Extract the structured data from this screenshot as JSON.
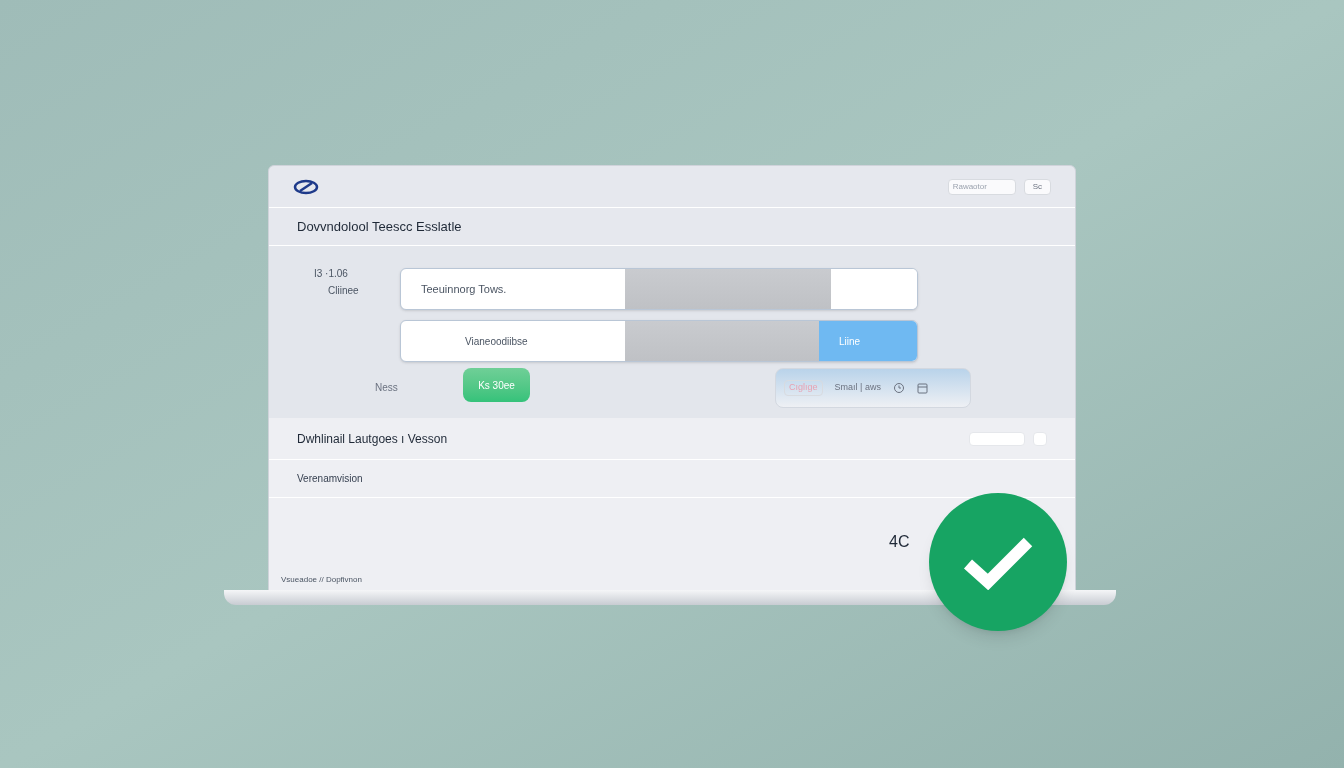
{
  "header": {
    "search": {
      "placeholder": "Rawaotor"
    },
    "button": "Sc"
  },
  "title": "Dovvndolool Teescc Esslatle",
  "form": {
    "labels": [
      "I3 ·1.06",
      "Cliinee"
    ],
    "bars": [
      {
        "text": "Teeuinnorg Tows."
      },
      {
        "text": "Vianeoodiibse",
        "button": "Liine"
      }
    ],
    "note_label": "Ness",
    "green_button": "Ks 30ee",
    "pill": {
      "tag": "Cıglıge",
      "text": "Smaıl | aws"
    }
  },
  "section": {
    "checkbox_checked": false,
    "title": "Dwhlinail Lautgoes ı Vesson",
    "subtitle": "Verenamvision",
    "value": "4C",
    "footer": "Vsueadoe // Dopfivnon"
  },
  "status": {
    "checked": true
  }
}
